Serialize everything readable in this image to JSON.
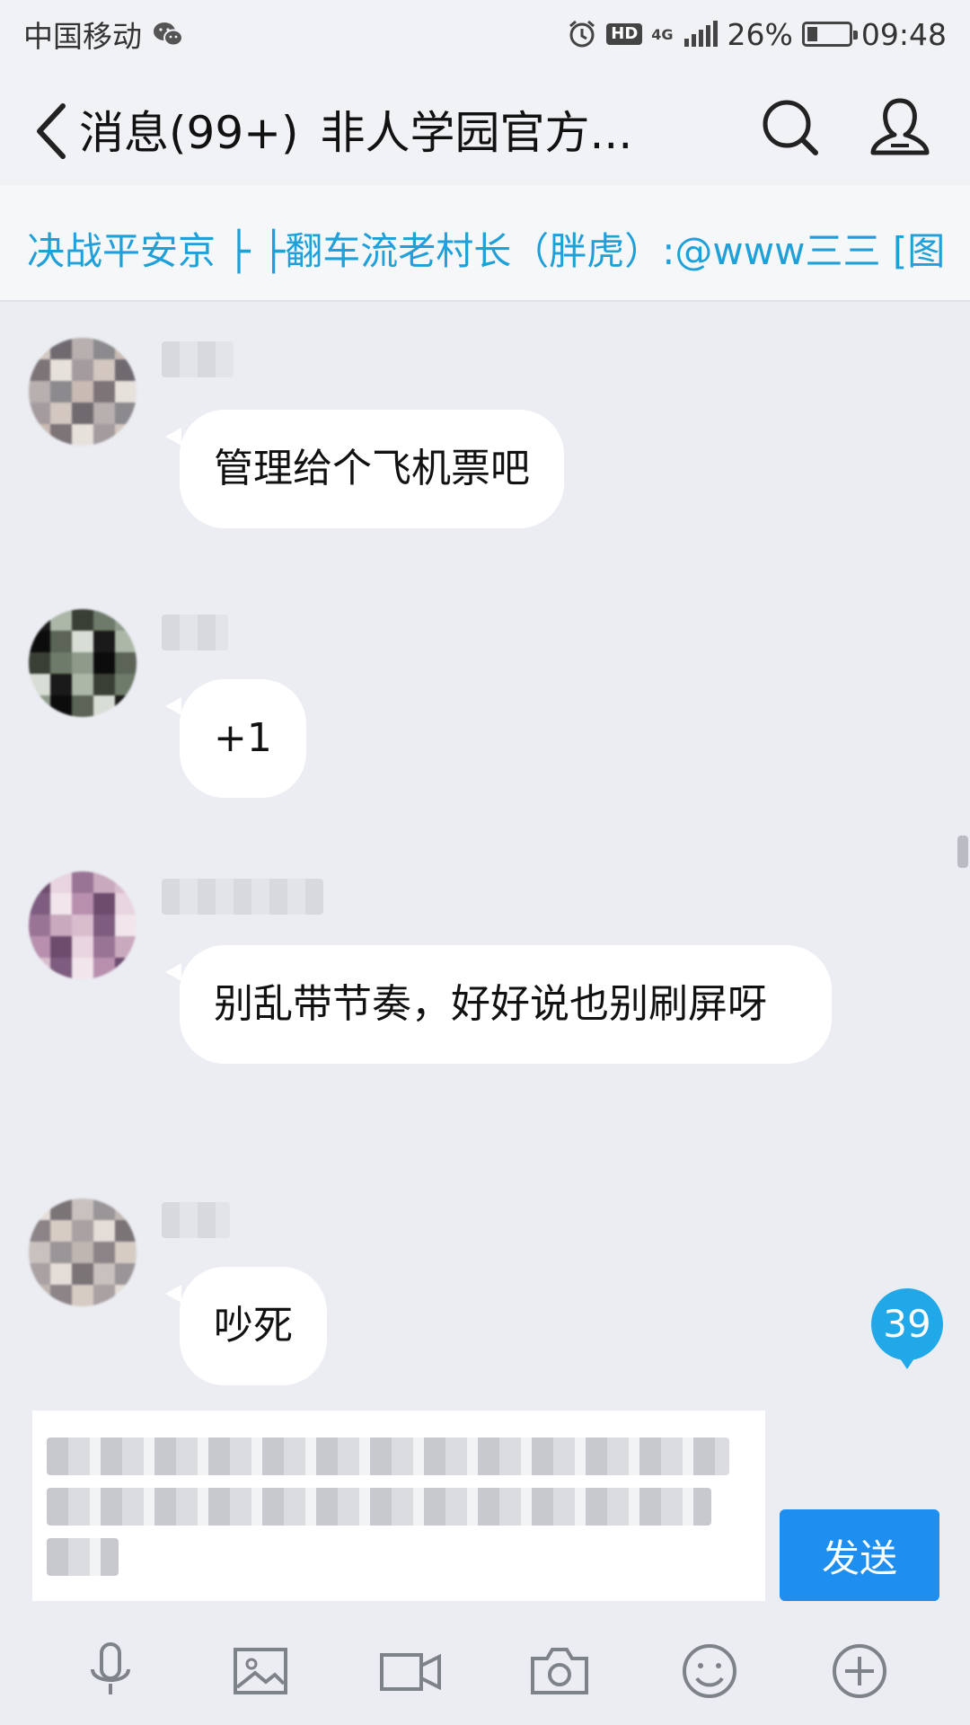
{
  "status_bar": {
    "carrier": "中国移动",
    "network": "4G",
    "hd_label": "HD",
    "battery_percent": "26%",
    "battery_level": 0.26,
    "time": "09:48"
  },
  "header": {
    "back_label": "消息(99+)",
    "group_name": "非人学园官方..."
  },
  "notice": {
    "text": "决战平安京 ├ ├翻车流老村长（胖虎）:@www三三 [图"
  },
  "messages": [
    {
      "text": "管理给个飞机票吧"
    },
    {
      "text": "+1"
    },
    {
      "text": "别乱带节奏，好好说也别刷屏呀"
    },
    {
      "text": "吵死"
    }
  ],
  "unread_count": "39",
  "composer": {
    "send_label": "发送"
  },
  "toolbar": {
    "icons": [
      "microphone-icon",
      "image-icon",
      "video-icon",
      "camera-icon",
      "emoji-icon",
      "plus-icon"
    ]
  },
  "colors": {
    "accent": "#1E8FF0",
    "notice_text": "#1FA0D9",
    "unread_badge": "#21A8E8",
    "background": "#EBEDF2"
  }
}
